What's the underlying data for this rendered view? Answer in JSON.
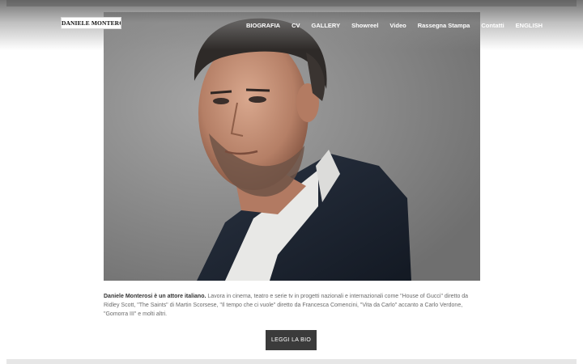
{
  "logo": {
    "text": "DANIELE MONTEROSI"
  },
  "nav": {
    "items": [
      {
        "label": "BIOGRAFIA"
      },
      {
        "label": "CV"
      },
      {
        "label": "GALLERY"
      },
      {
        "label": "Showreel"
      },
      {
        "label": "Video"
      },
      {
        "label": "Rassegna Stampa"
      },
      {
        "label": "Contatti"
      },
      {
        "label": "ENGLISH"
      }
    ]
  },
  "hero": {
    "image_subject": "portrait-photo"
  },
  "bio": {
    "lead": "Daniele Monterosi è un attore italiano.",
    "text": " Lavora in cinema, teatro e serie tv in progetti nazionali e internazionali come \"House of Gucci\" diretto da Ridley Scott, \"The Saints\" di Martin Scorsese, \"Il tempo che ci vuole\" diretto da Francesca Comencini, \"Vita da Carlo\" accanto a Carlo Verdone, \"Gomorra III\" e molti altri."
  },
  "cta": {
    "label": "LEGGI LA BIO"
  },
  "colors": {
    "button": "#3b3b3b",
    "text": "#6a6a6a",
    "nav_text": "#ffffff"
  }
}
